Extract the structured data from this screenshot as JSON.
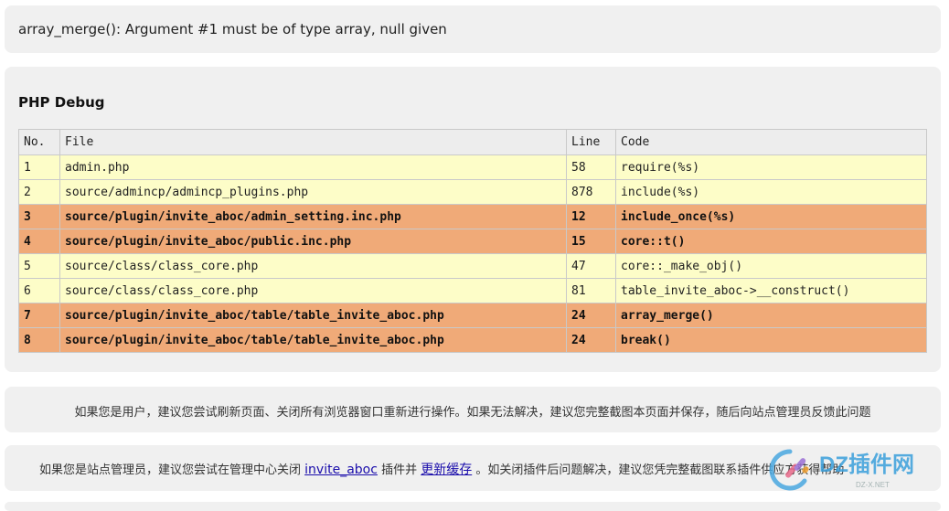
{
  "error": {
    "message": "array_merge(): Argument #1 must be of type array, null given"
  },
  "debug": {
    "title": "PHP Debug",
    "headers": {
      "no": "No.",
      "file": "File",
      "line": "Line",
      "code": "Code"
    },
    "rows": [
      {
        "no": "1",
        "file": "admin.php",
        "line": "58",
        "code": "require(%s)",
        "highlight": false
      },
      {
        "no": "2",
        "file": "source/admincp/admincp_plugins.php",
        "line": "878",
        "code": "include(%s)",
        "highlight": false
      },
      {
        "no": "3",
        "file": "source/plugin/invite_aboc/admin_setting.inc.php",
        "line": "12",
        "code": "include_once(%s)",
        "highlight": true
      },
      {
        "no": "4",
        "file": "source/plugin/invite_aboc/public.inc.php",
        "line": "15",
        "code": "core::t()",
        "highlight": true
      },
      {
        "no": "5",
        "file": "source/class/class_core.php",
        "line": "47",
        "code": "core::_make_obj()",
        "highlight": false
      },
      {
        "no": "6",
        "file": "source/class/class_core.php",
        "line": "81",
        "code": "table_invite_aboc->__construct()",
        "highlight": false
      },
      {
        "no": "7",
        "file": "source/plugin/invite_aboc/table/table_invite_aboc.php",
        "line": "24",
        "code": "array_merge()",
        "highlight": true
      },
      {
        "no": "8",
        "file": "source/plugin/invite_aboc/table/table_invite_aboc.php",
        "line": "24",
        "code": "break()",
        "highlight": true
      }
    ]
  },
  "tips": {
    "user": "如果您是用户，建议您尝试刷新页面、关闭所有浏览器窗口重新进行操作。如果无法解决，建议您完整截图本页面并保存，随后向站点管理员反馈此问题",
    "admin_prefix": "如果您是站点管理员，建议您尝试在管理中心关闭",
    "admin_plugin_link": "invite_aboc",
    "admin_middle": "插件并",
    "admin_cache_link": "更新缓存",
    "admin_suffix": "。如关闭插件后问题解决，建议您凭完整截图联系插件供应方获得帮助"
  },
  "watermark": {
    "brand": "DZ插件网",
    "site": "DZ-X.NET"
  },
  "colors": {
    "highlight_row": "#f0aa78",
    "normal_row": "#fdfdc8",
    "header_row": "#ededed",
    "panel": "#f0f0f0",
    "link": "#1a0dab"
  }
}
